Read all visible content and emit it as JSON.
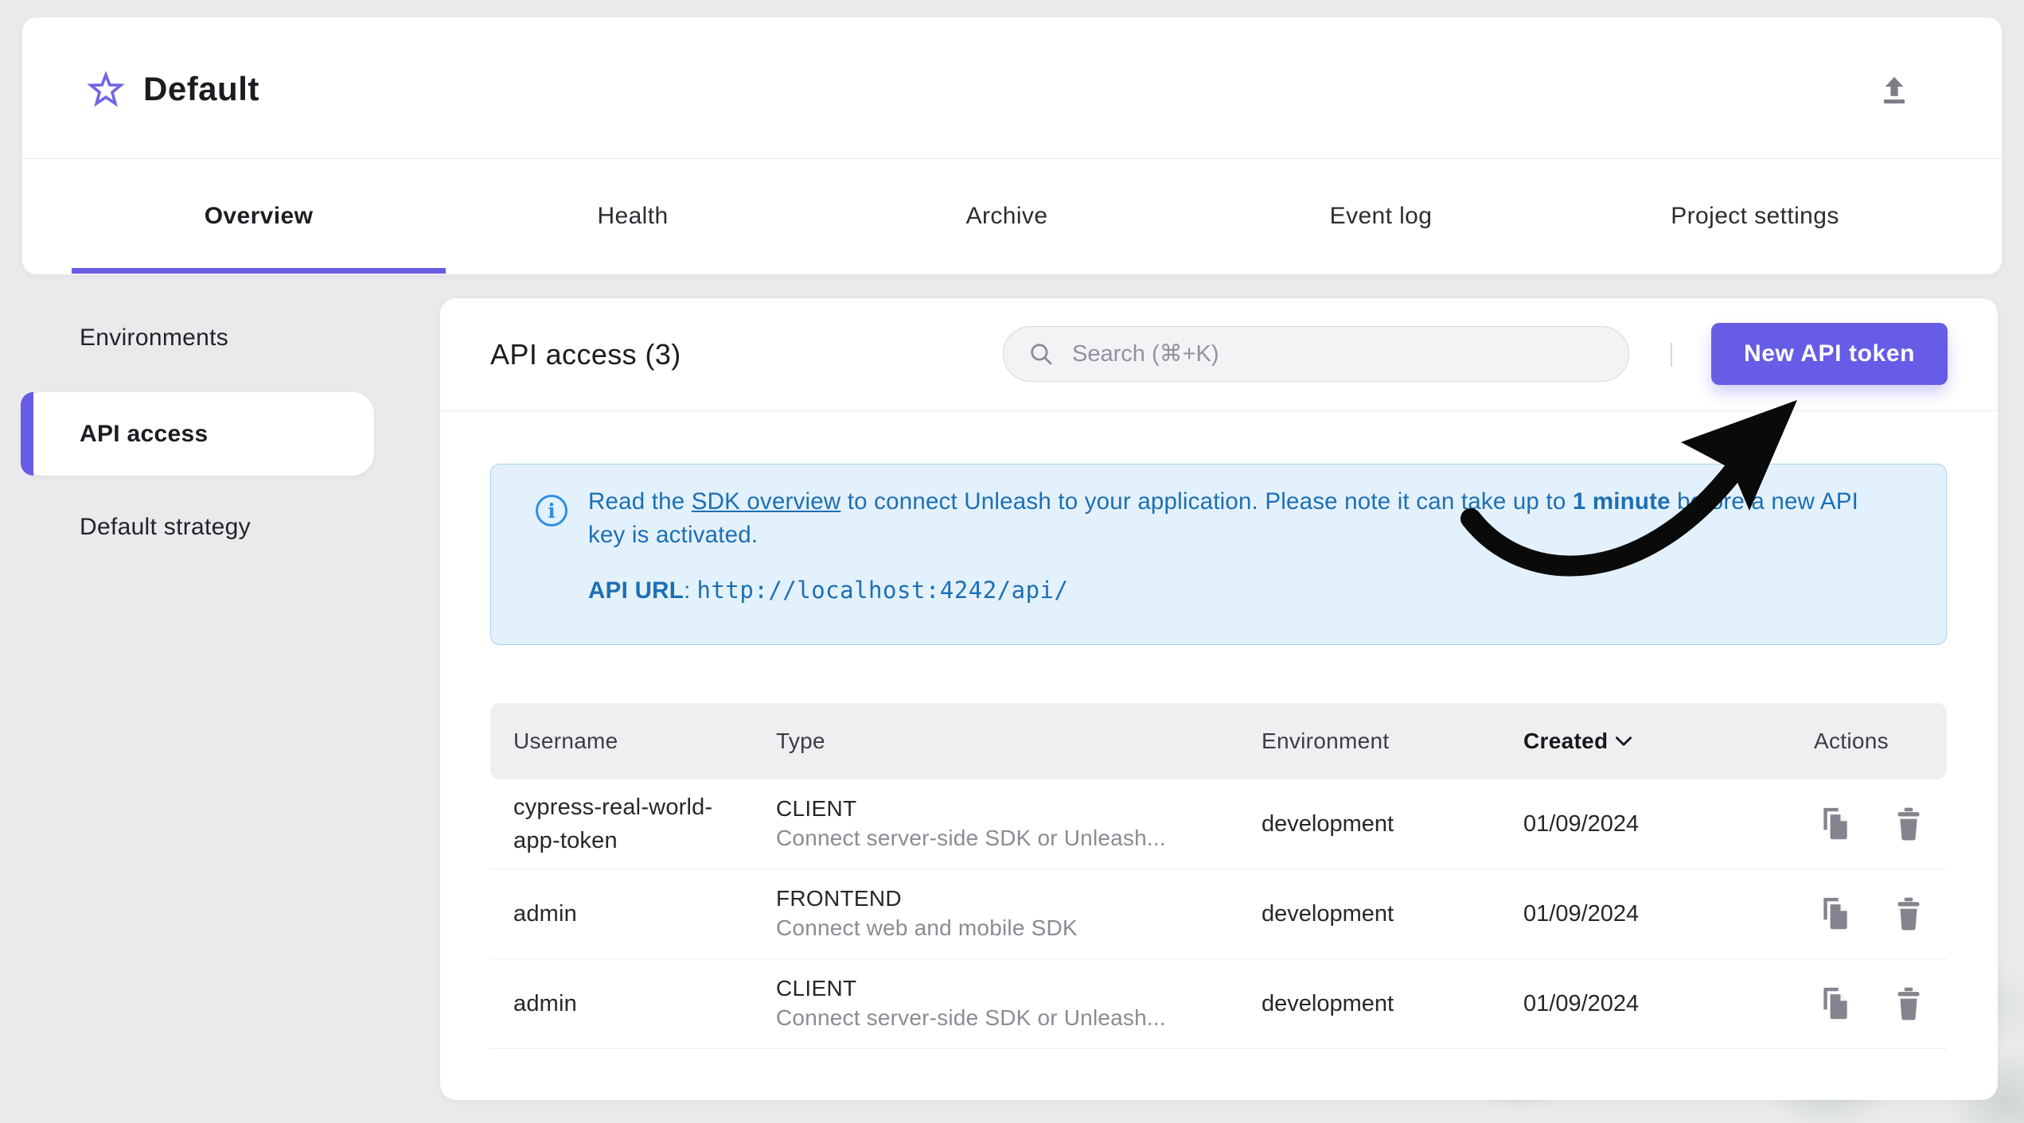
{
  "header": {
    "title": "Default"
  },
  "tabs": [
    {
      "label": "Overview",
      "active": true
    },
    {
      "label": "Health",
      "active": false
    },
    {
      "label": "Archive",
      "active": false
    },
    {
      "label": "Event log",
      "active": false
    },
    {
      "label": "Project settings",
      "active": false
    }
  ],
  "sidebar": {
    "items": [
      {
        "label": "Environments",
        "active": false
      },
      {
        "label": "API access",
        "active": true
      },
      {
        "label": "Default strategy",
        "active": false
      }
    ]
  },
  "toolbar": {
    "title": "API access (3)",
    "search_placeholder": "Search (⌘+K)",
    "new_token_label": "New API token"
  },
  "alert": {
    "segments": [
      {
        "text": "Read the "
      },
      {
        "text": "SDK overview"
      },
      {
        "text": " to connect Unleash to your application. Please note it can take up to "
      },
      {
        "text": "1 minute"
      },
      {
        "text": " before a new API key is activated."
      }
    ],
    "api_url_label": "API URL",
    "api_url_separator": ": ",
    "api_url": "http://localhost:4242/api/"
  },
  "table": {
    "columns": [
      "Username",
      "Type",
      "Environment",
      "Created",
      "Actions"
    ],
    "sorted_column": "Created",
    "sort_direction": "desc",
    "rows": [
      {
        "username": "cypress-real-world-app-token",
        "type": "CLIENT",
        "type_description": "Connect server-side SDK or Unleash...",
        "environment": "development",
        "created": "01/09/2024"
      },
      {
        "username": "admin",
        "type": "FRONTEND",
        "type_description": "Connect web and mobile SDK",
        "environment": "development",
        "created": "01/09/2024"
      },
      {
        "username": "admin",
        "type": "CLIENT",
        "type_description": "Connect server-side SDK or Unleash...",
        "environment": "development",
        "created": "01/09/2024"
      }
    ]
  },
  "colors": {
    "accent": "#675ce5",
    "info_text": "#1d6fb4",
    "info_bg": "#e3f1fc",
    "info_border": "#a5d3f3",
    "icon_gray": "#84848e",
    "page_bg": "#eaeaec"
  }
}
